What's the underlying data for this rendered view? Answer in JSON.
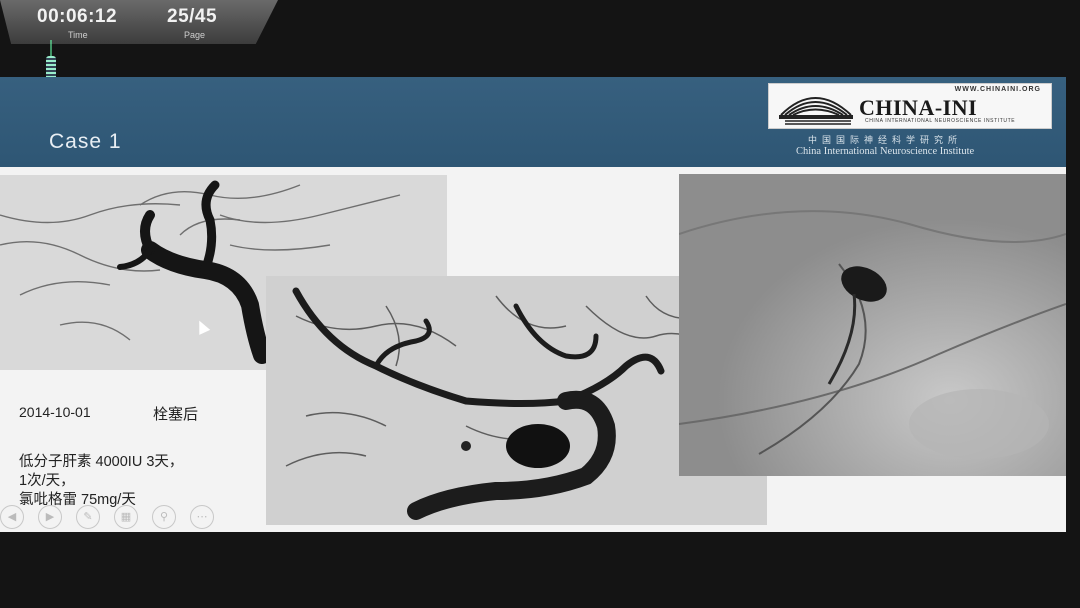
{
  "player": {
    "time_value": "00:06:12",
    "time_label": "Time",
    "page_value": "25/45",
    "page_label": "Page"
  },
  "slide": {
    "title": "Case 1",
    "logo": {
      "url": "WWW.CHINAINI.ORG",
      "name": "CHINA-INI",
      "subline": "CHINA INTERNATIONAL NEUROSCIENCE INSTITUTE",
      "chinese": "中国国际神经科学研究所",
      "english": "China International Neuroscience Institute"
    },
    "notes": {
      "date": "2014-10-01",
      "diagnosis": "栓塞后",
      "treatment_lines": [
        "低分子肝素 4000IU 3天，",
        "1次/天，",
        "氯吡格雷 75mg/天"
      ]
    },
    "controls": [
      "prev-icon",
      "next-icon",
      "pen-icon",
      "slides-icon",
      "zoom-icon",
      "more-icon"
    ]
  },
  "colors": {
    "header": "#2e5674",
    "slide_bg": "#f3f3f3",
    "background": "#141414"
  }
}
